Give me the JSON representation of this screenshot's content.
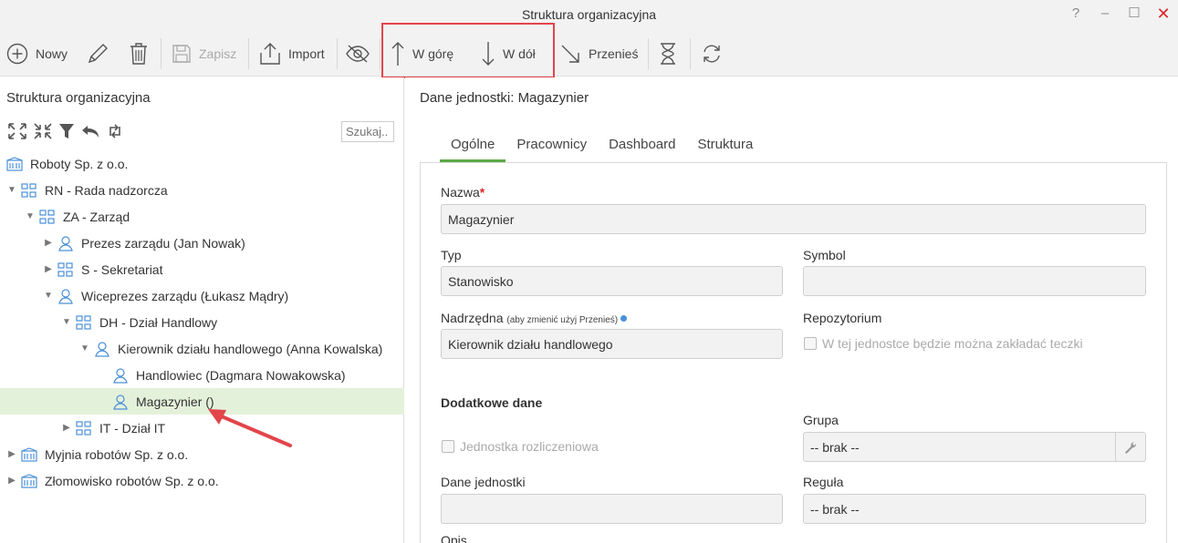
{
  "window": {
    "title": "Struktura organizacyjna",
    "help": "?",
    "minimize": "–",
    "maximize": "☐",
    "close": "✕"
  },
  "toolbar": {
    "new_label": "Nowy",
    "save_label": "Zapisz",
    "import_label": "Import",
    "up_label": "W górę",
    "down_label": "W dół",
    "move_label": "Przenieś"
  },
  "colors": {
    "accent_green": "#5aa945",
    "selected_row": "#e4f1da",
    "highlight_red": "#e2454a",
    "icon_blue": "#4a90d9"
  },
  "left": {
    "title": "Struktura organizacyjna",
    "search_placeholder": "Szukaj..",
    "tools": [
      "expand-all-icon",
      "collapse-all-icon",
      "filter-icon",
      "undo-icon",
      "refresh-icon"
    ],
    "tree": [
      {
        "label": "Roboty Sp. z o.o.",
        "level": 0,
        "toggle": "none",
        "icon": "company-icon",
        "selected": false
      },
      {
        "label": "RN - Rada nadzorcza",
        "level": 0,
        "toggle": "open",
        "icon": "department-icon",
        "selected": false
      },
      {
        "label": "ZA - Zarząd",
        "level": 1,
        "toggle": "open",
        "icon": "department-icon",
        "selected": false
      },
      {
        "label": "Prezes zarządu (Jan Nowak)",
        "level": 2,
        "toggle": "closed",
        "icon": "person-icon",
        "selected": false
      },
      {
        "label": "S - Sekretariat",
        "level": 2,
        "toggle": "closed",
        "icon": "department-icon",
        "selected": false
      },
      {
        "label": "Wiceprezes zarządu (Łukasz Mądry)",
        "level": 2,
        "toggle": "open",
        "icon": "person-icon",
        "selected": false
      },
      {
        "label": "DH - Dział Handlowy",
        "level": 3,
        "toggle": "open",
        "icon": "department-icon",
        "selected": false
      },
      {
        "label": "Kierownik działu handlowego (Anna Kowalska)",
        "level": 4,
        "toggle": "open",
        "icon": "person-icon",
        "selected": false
      },
      {
        "label": "Handlowiec (Dagmara Nowakowska)",
        "level": 5,
        "toggle": "none",
        "icon": "person-icon",
        "selected": false
      },
      {
        "label": "Magazynier ()",
        "level": 5,
        "toggle": "none",
        "icon": "person-icon",
        "selected": true
      },
      {
        "label": "IT - Dział IT",
        "level": 3,
        "toggle": "closed",
        "icon": "department-icon",
        "selected": false
      },
      {
        "label": "Myjnia robotów Sp. z o.o.",
        "level": 0,
        "toggle": "closed",
        "icon": "company-icon",
        "selected": false
      },
      {
        "label": "Złomowisko robotów Sp. z o.o.",
        "level": 0,
        "toggle": "closed",
        "icon": "company-icon",
        "selected": false
      }
    ]
  },
  "detail": {
    "title": "Dane jednostki: Magazynier",
    "tabs": [
      "Ogólne",
      "Pracownicy",
      "Dashboard",
      "Struktura"
    ],
    "active_tab": "Ogólne",
    "form": {
      "name_label": "Nazwa",
      "name_required_mark": "*",
      "name_value": "Magazynier",
      "type_label": "Typ",
      "type_value": "Stanowisko",
      "symbol_label": "Symbol",
      "symbol_value": "",
      "parent_label": "Nadrzędna",
      "parent_hint": "(aby zmienić użyj Przenieś)",
      "parent_value": "Kierownik działu handlowego",
      "repo_label": "Repozytorium",
      "repo_checkbox": "W tej jednostce będzie można zakładać teczki",
      "extra_heading": "Dodatkowe dane",
      "group_label": "Grupa",
      "group_value": "-- brak --",
      "billing_checkbox": "Jednostka rozliczeniowa",
      "unit_data_label": "Dane jednostki",
      "unit_data_value": "",
      "rule_label": "Reguła",
      "rule_value": "-- brak --",
      "desc_label": "Opis"
    }
  }
}
